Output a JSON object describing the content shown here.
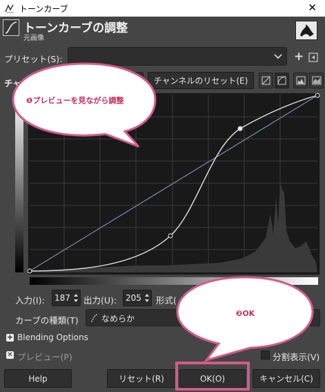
{
  "window": {
    "title": "トーンカーブ",
    "close_glyph": "✕"
  },
  "header": {
    "title": "トーンカーブの調整",
    "subtitle": "元画像"
  },
  "preset": {
    "label": "プリセット(S):",
    "value": "",
    "add_glyph": "+"
  },
  "channel": {
    "label_partial": "チャ",
    "reset_label": "チャンネルのリセット(E)"
  },
  "io": {
    "input_label": "入力(I):",
    "input_value": "187",
    "output_label": "出力(U):",
    "output_value": "205",
    "format_label_partial": "形式("
  },
  "curve_type": {
    "label": "カーブの種類(T)",
    "value": "なめらか"
  },
  "blending": {
    "label": "Blending Options",
    "expander": "+"
  },
  "preview": {
    "label": "プレビュー(P)",
    "checked_glyph": "✕"
  },
  "split_view": {
    "label": "分割表示(V)"
  },
  "buttons": {
    "help": "Help",
    "reset": "リセット(R)",
    "ok": "OK(O)",
    "cancel": "キャンセル(C)"
  },
  "callouts": [
    {
      "text": "❶プレビューを見ながら調整"
    },
    {
      "text": "❷OK"
    }
  ],
  "colors": {
    "accent": "#d25b8a",
    "callout_text": "#c0305f",
    "background": "#454545"
  }
}
